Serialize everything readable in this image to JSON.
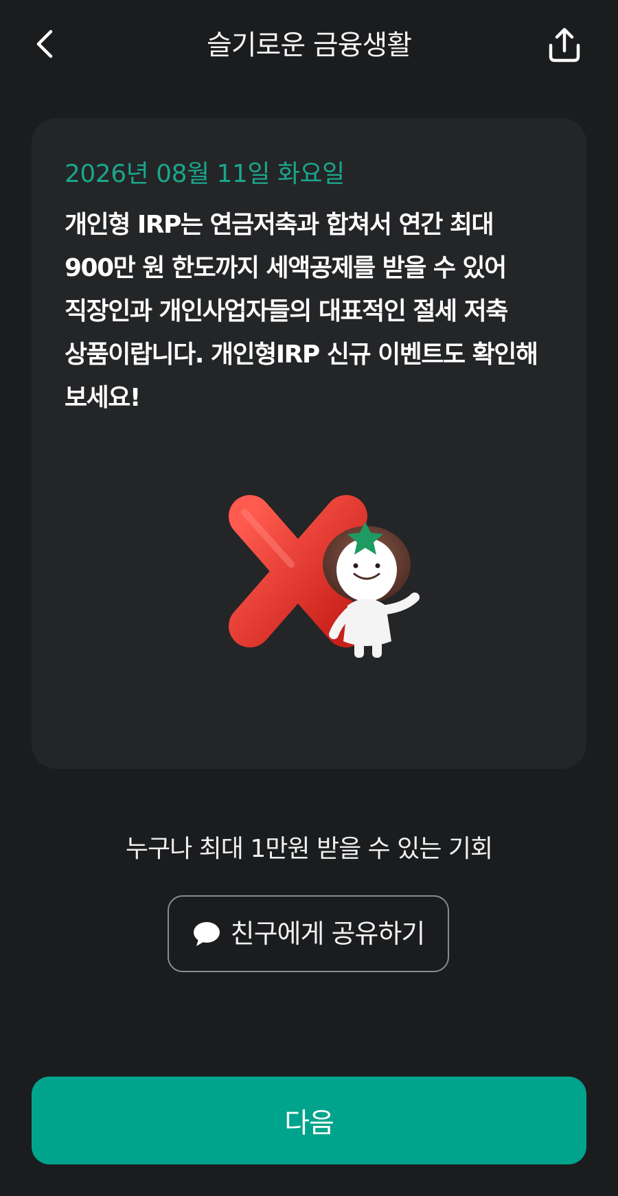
{
  "header": {
    "title": "슬기로운 금융생활",
    "back_icon": "chevron-left-icon",
    "share_icon": "share-upload-icon"
  },
  "card": {
    "date": "2026년 08월 11일 화요일",
    "body": "개인형 IRP는 연금저축과 합쳐서 연간 최대 900만 원 한도까지 세액공제를 받을 수 있어 직장인과 개인사업자들의 대표적인 절세 저축 상품이랍니다. 개인형IRP 신규 이벤트도 확인해 보세요!",
    "illustration": "red-x-with-mascot"
  },
  "promo": {
    "text": "누구나 최대 1만원 받을 수 있는 기회"
  },
  "share_button": {
    "icon": "chat-bubble-icon",
    "label": "친구에게 공유하기"
  },
  "next_button": {
    "label": "다음"
  },
  "colors": {
    "background": "#1b1c1e",
    "card": "#242527",
    "accent": "#00a48c",
    "date_text": "#1aa68c",
    "x_red": "#e8322b"
  }
}
